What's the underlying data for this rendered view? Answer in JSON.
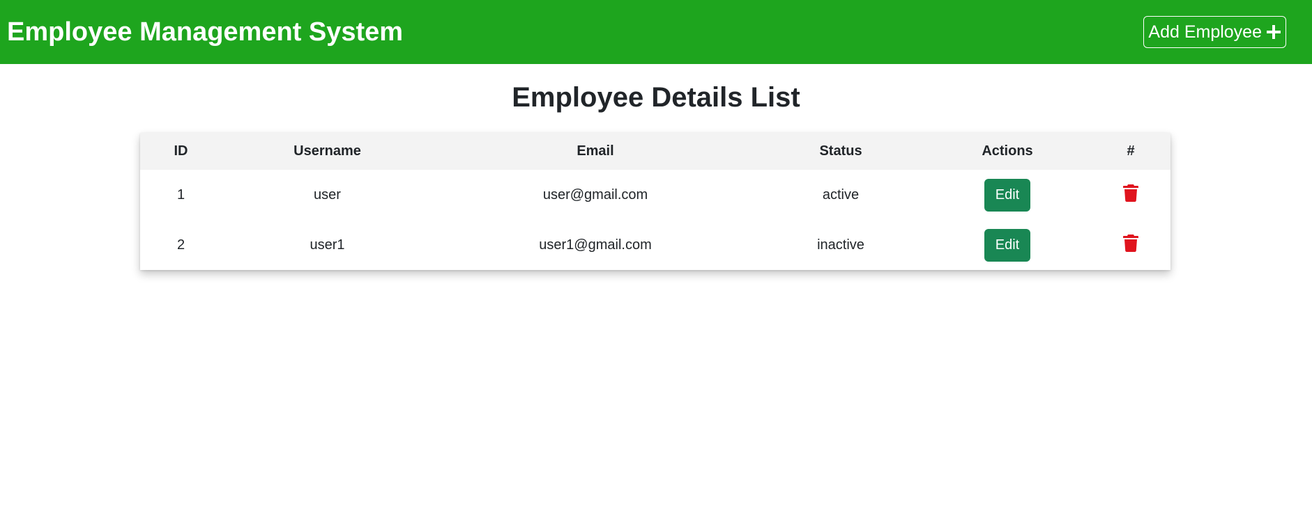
{
  "navbar": {
    "brand": "Employee Management System",
    "add_button_label": "Add Employee",
    "background_color": "#1ea51e"
  },
  "page": {
    "title": "Employee Details List"
  },
  "table": {
    "headers": {
      "id": "ID",
      "username": "Username",
      "email": "Email",
      "status": "Status",
      "actions": "Actions",
      "delete": "#"
    },
    "rows": [
      {
        "id": "1",
        "username": "user",
        "email": "user@gmail.com",
        "status": "active",
        "edit_label": "Edit"
      },
      {
        "id": "2",
        "username": "user1",
        "email": "user1@gmail.com",
        "status": "inactive",
        "edit_label": "Edit"
      }
    ],
    "edit_button_color": "#198754",
    "delete_icon_color": "#e0141e",
    "delete_icon": "trash-icon"
  }
}
